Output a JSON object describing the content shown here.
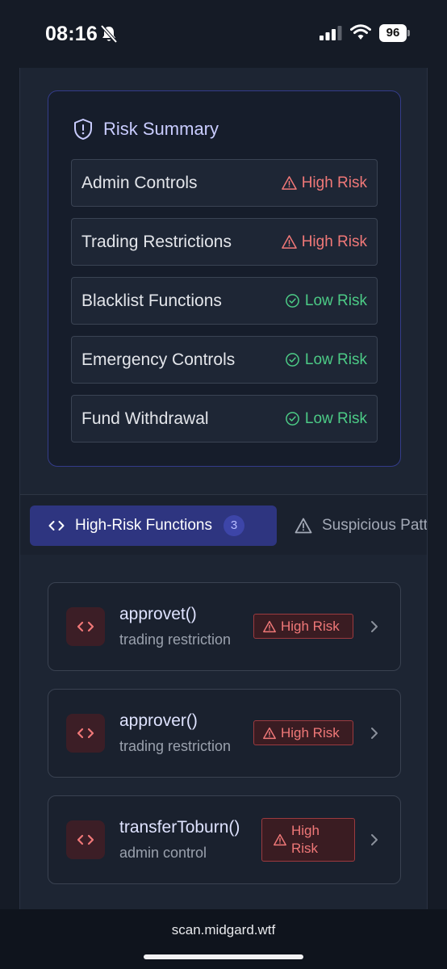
{
  "status_bar": {
    "time": "08:16",
    "battery": "96"
  },
  "risk_summary": {
    "title": "Risk Summary",
    "rows": [
      {
        "label": "Admin Controls",
        "risk": "High Risk",
        "level": "high"
      },
      {
        "label": "Trading Restrictions",
        "risk": "High Risk",
        "level": "high"
      },
      {
        "label": "Blacklist Functions",
        "risk": "Low Risk",
        "level": "low"
      },
      {
        "label": "Emergency Controls",
        "risk": "Low Risk",
        "level": "low"
      },
      {
        "label": "Fund Withdrawal",
        "risk": "Low Risk",
        "level": "low"
      }
    ]
  },
  "tabs": [
    {
      "label": "High-Risk Functions",
      "count": "3",
      "active": true
    },
    {
      "label": "Suspicious Patterns",
      "active": false
    }
  ],
  "functions": [
    {
      "name": "approvet()",
      "type": "trading restriction",
      "risk": "High Risk"
    },
    {
      "name": "approver()",
      "type": "trading restriction",
      "risk": "High Risk"
    },
    {
      "name": "transferToburn()",
      "type": "admin control",
      "risk_line1": "High",
      "risk_line2": "Risk"
    }
  ],
  "browser": {
    "url": "scan.midgard.wtf"
  },
  "colors": {
    "high_risk": "#f07878",
    "low_risk": "#4ccb86",
    "accent": "#2e3580",
    "title": "#c9ccff"
  },
  "icons": [
    "bell-off-icon",
    "signal-icon",
    "wifi-icon",
    "battery-icon",
    "shield-icon",
    "warning-triangle-icon",
    "check-circle-icon",
    "code-icon",
    "chevron-right-icon"
  ]
}
